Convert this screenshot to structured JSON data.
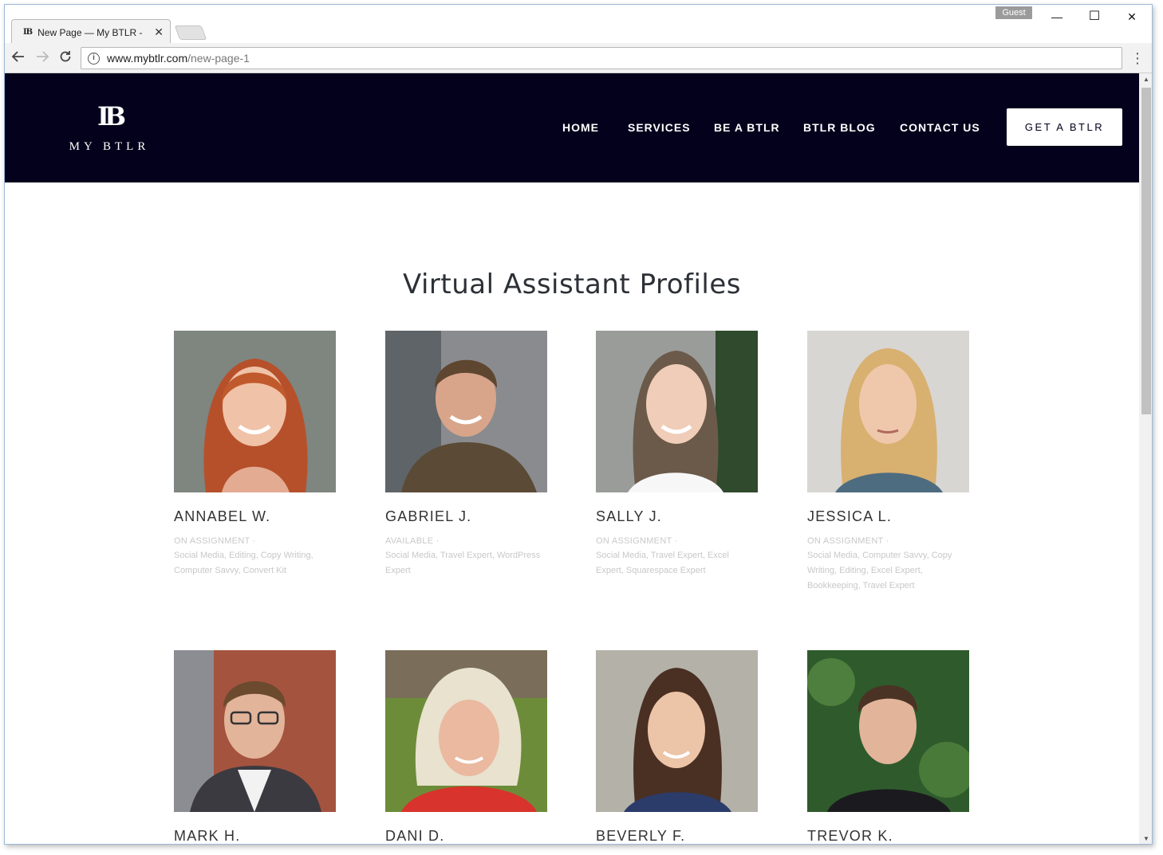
{
  "browser": {
    "tab_title": "New Page — My BTLR - ",
    "tab_favicon": "IB",
    "tab_close": "✕",
    "guest_badge": "Guest",
    "url_domain": "www.mybtlr.com",
    "url_path": "/new-page-1",
    "minimize": "—",
    "maximize": "☐",
    "close": "✕"
  },
  "site": {
    "logo_mark": "IB",
    "logo_text": "MY BTLR",
    "nav": [
      "HOME",
      "SERVICES",
      "BE A BTLR",
      "BTLR BLOG",
      "CONTACT US"
    ],
    "cta": "GET A BTLR",
    "header_color": "#03011b"
  },
  "page": {
    "title": "Virtual Assistant Profiles"
  },
  "profiles": [
    {
      "name": "ANNABEL W.",
      "status": "ON ASSIGNMENT  ·",
      "skills": "Social Media, Editing, Copy Writing, Computer Savvy, Convert Kit"
    },
    {
      "name": "GABRIEL J.",
      "status": "AVAILABLE  ·",
      "skills": "Social Media, Travel Expert, WordPress Expert"
    },
    {
      "name": "SALLY J.",
      "status": "ON ASSIGNMENT  ·",
      "skills": "Social Media, Travel Expert, Excel Expert, Squarespace Expert"
    },
    {
      "name": "JESSICA L.",
      "status": "ON ASSIGNMENT  ·",
      "skills": "Social Media, Computer Savvy, Copy Writing, Editing, Excel Expert, Bookkeeping, Travel Expert"
    },
    {
      "name": "MARK H."
    },
    {
      "name": "DANI D."
    },
    {
      "name": "BEVERLY F."
    },
    {
      "name": "TREVOR K."
    }
  ]
}
